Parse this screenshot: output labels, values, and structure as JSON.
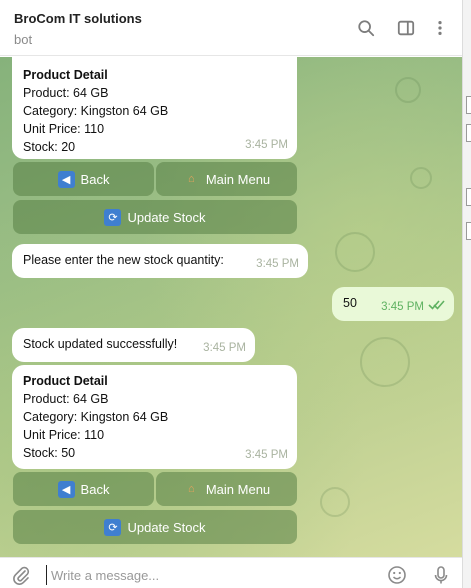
{
  "header": {
    "title": "BroCom IT solutions",
    "subtitle": "bot",
    "icons": [
      "search-icon",
      "sidebar-toggle-icon",
      "more-vertical-icon"
    ]
  },
  "messages": [
    {
      "direction": "incoming",
      "title": "Product Detail",
      "lines": [
        "Product: 64 GB",
        "Category: Kingston 64 GB",
        "Unit Price: 110",
        "Stock: 20"
      ],
      "time": "3:45 PM",
      "keyboard": [
        [
          "🔙 Back",
          "🏠 Main Menu"
        ],
        [
          "🔄 Update Stock"
        ]
      ]
    },
    {
      "direction": "incoming",
      "text": "Please enter the new stock quantity:",
      "time": "3:45 PM"
    },
    {
      "direction": "outgoing",
      "text": "50",
      "time": "3:45 PM",
      "status": "read"
    },
    {
      "direction": "incoming",
      "text": "Stock updated successfully!",
      "time": "3:45 PM"
    },
    {
      "direction": "incoming",
      "title": "Product Detail",
      "lines": [
        "Product: 64 GB",
        "Category: Kingston 64 GB",
        "Unit Price: 110",
        "Stock: 50"
      ],
      "time": "3:45 PM",
      "keyboard": [
        [
          "🔙 Back",
          "🏠 Main Menu"
        ],
        [
          "🔄 Update Stock"
        ]
      ]
    }
  ],
  "keyboard_labels": {
    "back": "Back",
    "main_menu": "Main Menu",
    "update_stock": "Update Stock"
  },
  "composer": {
    "placeholder": "Write a message...",
    "icons": [
      "paperclip-icon",
      "emoji-icon",
      "microphone-icon"
    ]
  },
  "colors": {
    "chat_bg": "#9dbf86",
    "outgoing_bubble": "#e9f9d8",
    "read_checks": "#5fb261",
    "keyboard_button": "#6f9661"
  }
}
